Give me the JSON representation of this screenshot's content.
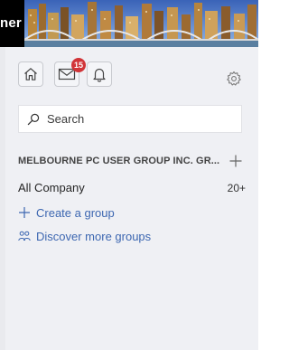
{
  "header": {
    "brand_text": "ner"
  },
  "colors": {
    "accent": "#3d67b1",
    "badge": "#d13438",
    "panel_bg": "#eff0f4"
  },
  "nav": {
    "home_icon": "home-icon",
    "mail_icon": "mail-icon",
    "mail_badge": "15",
    "bell_icon": "bell-icon",
    "settings_icon": "gear-icon"
  },
  "search": {
    "placeholder": "Search",
    "value": ""
  },
  "network": {
    "name": "MELBOURNE PC USER GROUP INC. GR...",
    "add_icon": "plus-icon"
  },
  "groups": [
    {
      "name": "All Company",
      "count": "20+"
    }
  ],
  "actions": {
    "create_group": "Create a group",
    "discover_groups": "Discover more groups"
  }
}
